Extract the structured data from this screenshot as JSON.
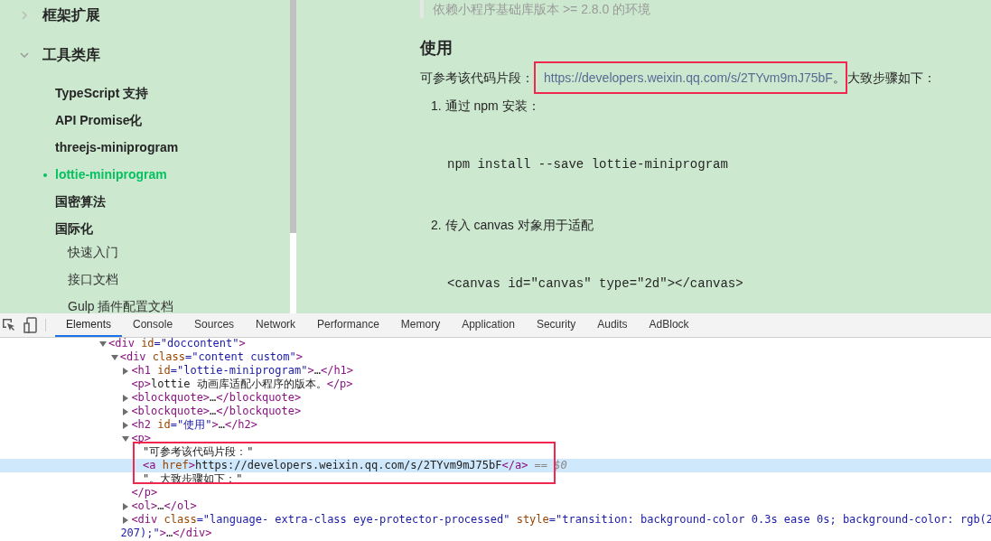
{
  "sidebar": {
    "items": [
      {
        "label": "框架扩展",
        "expanded": false,
        "selected": false
      },
      {
        "label": "工具类库",
        "expanded": true,
        "selected": false,
        "children": [
          {
            "label": "TypeScript 支持",
            "selected": false
          },
          {
            "label": "API Promise化",
            "selected": false
          },
          {
            "label": "threejs-miniprogram",
            "selected": false
          },
          {
            "label": "lottie-miniprogram",
            "selected": true
          },
          {
            "label": "国密算法",
            "selected": false
          },
          {
            "label": "国际化",
            "selected": false,
            "children": [
              {
                "label": "快速入门",
                "selected": false
              },
              {
                "label": "接口文档",
                "selected": false
              },
              {
                "label": "Gulp 插件配置文档",
                "selected": false
              }
            ]
          }
        ]
      }
    ]
  },
  "content": {
    "blockquote": "依赖小程序基础库版本 >= 2.8.0 的环境",
    "heading": "使用",
    "paragraph": {
      "lead": "可参考该代码片段：",
      "framed": [
        {
          "kind": "link",
          "text": "https://developers.weixin.qq.com/s/2TYvm9mJ75bF"
        },
        {
          "kind": "text",
          "text": "。"
        }
      ],
      "tail": "大致步骤如下："
    },
    "steps": [
      {
        "number": "1.",
        "text": "通过 npm 安装：",
        "code": "npm install --save lottie-miniprogram"
      },
      {
        "number": "2.",
        "text": "传入 canvas 对象用于适配",
        "code": "<canvas id=\"canvas\" type=\"2d\"></canvas>"
      }
    ]
  },
  "devtools": {
    "tabs": [
      {
        "label": "Elements",
        "selected": true
      },
      {
        "label": "Console",
        "selected": false
      },
      {
        "label": "Sources",
        "selected": false
      },
      {
        "label": "Network",
        "selected": false
      },
      {
        "label": "Performance",
        "selected": false
      },
      {
        "label": "Memory",
        "selected": false
      },
      {
        "label": "Application",
        "selected": false
      },
      {
        "label": "Security",
        "selected": false
      },
      {
        "label": "Audits",
        "selected": false
      },
      {
        "label": "AdBlock",
        "selected": false
      }
    ],
    "tree": [
      {
        "expanded": true,
        "selected": false,
        "tokens": [
          {
            "kind": "tag",
            "text": "<div "
          },
          {
            "kind": "attr",
            "text": "id"
          },
          {
            "kind": "val",
            "text": "=\"doccontent\""
          },
          {
            "kind": "tag",
            "text": ">"
          }
        ],
        "children": [
          {
            "expanded": true,
            "selected": false,
            "tokens": [
              {
                "kind": "tag",
                "text": "<div "
              },
              {
                "kind": "attr",
                "text": "class"
              },
              {
                "kind": "val",
                "text": "=\"content custom\""
              },
              {
                "kind": "tag",
                "text": ">"
              }
            ],
            "children": [
              {
                "expanded": false,
                "selected": false,
                "tokens": [
                  {
                    "kind": "tag",
                    "text": "<h1 "
                  },
                  {
                    "kind": "attr",
                    "text": "id"
                  },
                  {
                    "kind": "val",
                    "text": "=\"lottie-miniprogram\""
                  },
                  {
                    "kind": "tag",
                    "text": ">"
                  },
                  {
                    "kind": "text",
                    "text": "…"
                  },
                  {
                    "kind": "tag",
                    "text": "</h1>"
                  }
                ]
              },
              {
                "selected": false,
                "tokens": [
                  {
                    "kind": "tag",
                    "text": "<p>"
                  },
                  {
                    "kind": "text",
                    "text": "lottie 动画库适配小程序的版本。"
                  },
                  {
                    "kind": "tag",
                    "text": "</p>"
                  }
                ]
              },
              {
                "expanded": false,
                "selected": false,
                "tokens": [
                  {
                    "kind": "tag",
                    "text": "<blockquote>"
                  },
                  {
                    "kind": "text",
                    "text": "…"
                  },
                  {
                    "kind": "tag",
                    "text": "</blockquote>"
                  }
                ]
              },
              {
                "expanded": false,
                "selected": false,
                "tokens": [
                  {
                    "kind": "tag",
                    "text": "<blockquote>"
                  },
                  {
                    "kind": "text",
                    "text": "…"
                  },
                  {
                    "kind": "tag",
                    "text": "</blockquote>"
                  }
                ]
              },
              {
                "expanded": false,
                "selected": false,
                "tokens": [
                  {
                    "kind": "tag",
                    "text": "<h2 "
                  },
                  {
                    "kind": "attr",
                    "text": "id"
                  },
                  {
                    "kind": "val",
                    "text": "=\"使用\""
                  },
                  {
                    "kind": "tag",
                    "text": ">"
                  },
                  {
                    "kind": "text",
                    "text": "…"
                  },
                  {
                    "kind": "tag",
                    "text": "</h2>"
                  }
                ]
              },
              {
                "expanded": true,
                "selected": false,
                "tokens": [
                  {
                    "kind": "tag",
                    "text": "<p>"
                  }
                ],
                "closing": [
                  {
                    "kind": "tag",
                    "text": "</p>"
                  }
                ],
                "children": [
                  {
                    "selected": false,
                    "framed": true,
                    "tokens": [
                      {
                        "kind": "text",
                        "text": "\"可参考该代码片段：\""
                      }
                    ]
                  },
                  {
                    "selected": true,
                    "framed": true,
                    "tokens": [
                      {
                        "kind": "tag",
                        "text": "<a "
                      },
                      {
                        "kind": "attr",
                        "text": "href"
                      },
                      {
                        "kind": "tag",
                        "text": ">"
                      },
                      {
                        "kind": "text",
                        "text": "https://developers.weixin.qq.com/s/2TYvm9mJ75bF"
                      },
                      {
                        "kind": "tag",
                        "text": "</a>"
                      },
                      {
                        "kind": "ghost",
                        "text": " == $0"
                      }
                    ]
                  },
                  {
                    "selected": false,
                    "framed": true,
                    "tokens": [
                      {
                        "kind": "text",
                        "text": "\"。大致步骤如下：\""
                      }
                    ]
                  }
                ]
              },
              {
                "expanded": false,
                "selected": false,
                "tokens": [
                  {
                    "kind": "tag",
                    "text": "<ol>"
                  },
                  {
                    "kind": "text",
                    "text": "…"
                  },
                  {
                    "kind": "tag",
                    "text": "</ol>"
                  }
                ]
              },
              {
                "expanded": false,
                "selected": false,
                "tokens": [
                  {
                    "kind": "tag",
                    "text": "<div "
                  },
                  {
                    "kind": "attr",
                    "text": "class"
                  },
                  {
                    "kind": "val",
                    "text": "=\"language- extra-class eye-protector-processed\" "
                  },
                  {
                    "kind": "attr",
                    "text": "style"
                  },
                  {
                    "kind": "val",
                    "text": "=\"transition: background-color 0.3s ease 0s; background-color: rgb(2"
                  }
                ],
                "wrapped": [
                  {
                    "kind": "val",
                    "text": "207);\""
                  },
                  {
                    "kind": "tag",
                    "text": ">"
                  },
                  {
                    "kind": "text",
                    "text": "…"
                  },
                  {
                    "kind": "tag",
                    "text": "</div>"
                  }
                ]
              }
            ]
          }
        ]
      }
    ]
  }
}
